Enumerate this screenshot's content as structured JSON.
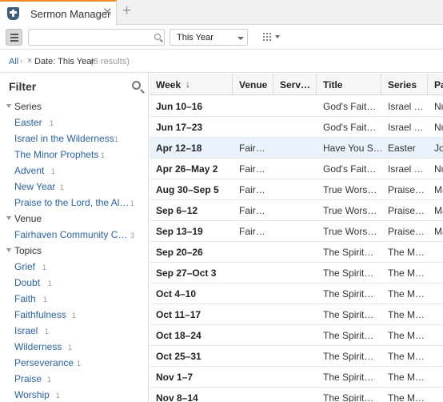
{
  "tab": {
    "title": "Sermon Manager",
    "close_glyph": "✕",
    "add_glyph": "+"
  },
  "toolbar": {
    "search_placeholder": "",
    "date_filter": "This Year"
  },
  "breadcrumb": {
    "all": "All",
    "sep": "›",
    "remove": "×",
    "filter": "Date: This Year",
    "count": "(6 results)"
  },
  "sidebar": {
    "title": "Filter",
    "groups": [
      {
        "label": "Series",
        "items": [
          {
            "label": "Easter",
            "count": "1"
          },
          {
            "label": "Israel in the Wilderness",
            "count": "1"
          },
          {
            "label": "The Minor Prophets",
            "count": "1"
          },
          {
            "label": "Advent",
            "count": "1"
          },
          {
            "label": "New Year",
            "count": "1"
          },
          {
            "label": "Praise to the Lord, the Al…",
            "count": "1"
          }
        ]
      },
      {
        "label": "Venue",
        "items": [
          {
            "label": "Fairhaven Community C…",
            "count": "3"
          }
        ]
      },
      {
        "label": "Topics",
        "items": [
          {
            "label": "Grief",
            "count": "1"
          },
          {
            "label": "Doubt",
            "count": "1"
          },
          {
            "label": "Faith",
            "count": "1"
          },
          {
            "label": "Faithfulness",
            "count": "1"
          },
          {
            "label": "Israel",
            "count": "1"
          },
          {
            "label": "Wilderness",
            "count": "1"
          },
          {
            "label": "Perseverance",
            "count": "1"
          },
          {
            "label": "Praise",
            "count": "1"
          },
          {
            "label": "Worship",
            "count": "1"
          }
        ]
      }
    ]
  },
  "table": {
    "sort_glyph": "↓",
    "columns": [
      "Week",
      "Venue",
      "Serv…",
      "Title",
      "Series",
      "Pa"
    ],
    "selected_row": 2,
    "rows": [
      [
        "Jun 10–16",
        "",
        "",
        "God's Fait…",
        "Israel …",
        "Nu"
      ],
      [
        "Jun 17–23",
        "",
        "",
        "God's Fait…",
        "Israel …",
        "Nu"
      ],
      [
        "Apr 12–18",
        "Fair…",
        "",
        "Have You S…",
        "Easter",
        "Jo"
      ],
      [
        "Apr 26–May 2",
        "Fair…",
        "",
        "God's Fait…",
        "Israel …",
        "Nu"
      ],
      [
        "Aug 30–Sep 5",
        "Fair…",
        "",
        "True Wors…",
        "Praise…",
        "Ma"
      ],
      [
        "Sep 6–12",
        "Fair…",
        "",
        "True Wors…",
        "Praise…",
        "Ma"
      ],
      [
        "Sep 13–19",
        "Fair…",
        "",
        "True Wors…",
        "Praise…",
        "Ma"
      ],
      [
        "Sep 20–26",
        "",
        "",
        "The Spirit…",
        "The M…",
        ""
      ],
      [
        "Sep 27–Oct 3",
        "",
        "",
        "The Spirit…",
        "The M…",
        ""
      ],
      [
        "Oct 4–10",
        "",
        "",
        "The Spirit…",
        "The M…",
        ""
      ],
      [
        "Oct 11–17",
        "",
        "",
        "The Spirit…",
        "The M…",
        ""
      ],
      [
        "Oct 18–24",
        "",
        "",
        "The Spirit…",
        "The M…",
        ""
      ],
      [
        "Oct 25–31",
        "",
        "",
        "The Spirit…",
        "The M…",
        ""
      ],
      [
        "Nov 1–7",
        "",
        "",
        "The Spirit…",
        "The M…",
        ""
      ],
      [
        "Nov 8–14",
        "",
        "",
        "The Spirit…",
        "The M…",
        ""
      ]
    ]
  }
}
